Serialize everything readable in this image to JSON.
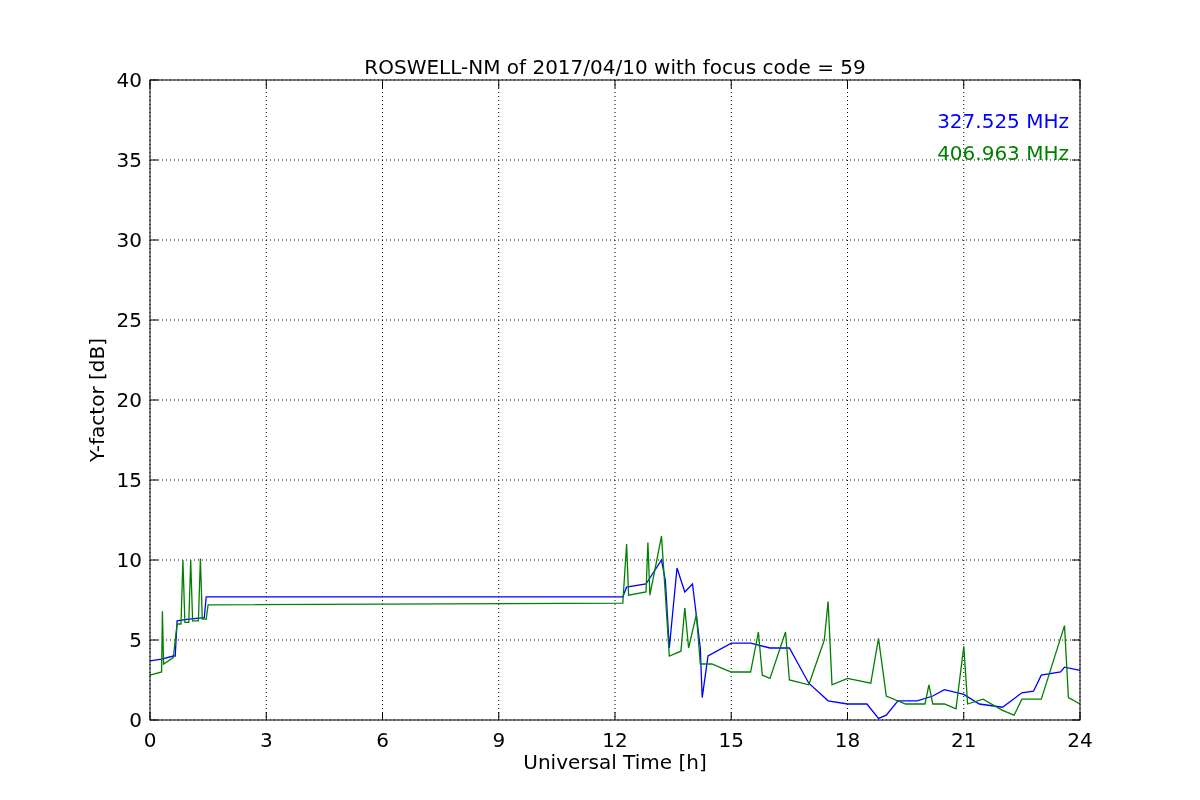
{
  "chart_data": {
    "type": "line",
    "title": "ROSWELL-NM of 2017/04/10 with focus code = 59",
    "xlabel": "Universal Time [h]",
    "ylabel": "Y-factor [dB]",
    "xlim": [
      0,
      24
    ],
    "ylim": [
      0,
      40
    ],
    "xticks": [
      0,
      3,
      6,
      9,
      12,
      15,
      18,
      21,
      24
    ],
    "yticks": [
      0,
      5,
      10,
      15,
      20,
      25,
      30,
      35,
      40
    ],
    "grid": true,
    "series": [
      {
        "name": "327.525 MHz",
        "color": "#0000ff",
        "x": [
          0,
          0.3,
          0.6,
          0.65,
          0.7,
          1.0,
          1.4,
          1.45,
          12.2,
          12.3,
          12.8,
          13.2,
          13.3,
          13.4,
          13.6,
          13.8,
          14.0,
          14.2,
          14.25,
          14.4,
          15,
          15.5,
          16,
          16.5,
          17,
          17.5,
          18,
          18.5,
          18.8,
          19.0,
          19.3,
          19.8,
          20.2,
          20.5,
          21,
          21.4,
          22,
          22.5,
          22.8,
          23,
          23.5,
          23.6,
          24
        ],
        "values": [
          3.7,
          3.8,
          4.0,
          4.0,
          6.2,
          6.3,
          6.4,
          7.7,
          7.7,
          8.3,
          8.5,
          10.0,
          8.7,
          4.5,
          9.5,
          8.0,
          8.5,
          4.5,
          1.4,
          4.0,
          4.8,
          4.8,
          4.5,
          4.5,
          2.3,
          1.2,
          1.0,
          1.0,
          0.1,
          0.3,
          1.2,
          1.2,
          1.5,
          1.9,
          1.6,
          1.0,
          0.8,
          1.7,
          1.8,
          2.8,
          3.0,
          3.3,
          3.1
        ]
      },
      {
        "name": "406.963 MHz",
        "color": "#008000",
        "x": [
          0,
          0.3,
          0.32,
          0.35,
          0.6,
          0.7,
          0.8,
          0.85,
          0.9,
          1.0,
          1.05,
          1.1,
          1.25,
          1.3,
          1.35,
          1.45,
          1.5,
          12.2,
          12.3,
          12.35,
          12.8,
          12.85,
          12.9,
          13.2,
          13.3,
          13.4,
          13.7,
          13.8,
          13.9,
          14.1,
          14.2,
          14.5,
          14.8,
          15,
          15.5,
          15.7,
          15.8,
          16,
          16.4,
          16.5,
          17,
          17.4,
          17.5,
          17.6,
          18,
          18.6,
          18.8,
          19,
          19.5,
          20,
          20.1,
          20.2,
          20.5,
          20.8,
          21.0,
          21.1,
          21.5,
          22,
          22.3,
          22.5,
          23,
          23.6,
          23.7,
          24
        ],
        "values": [
          2.8,
          3.0,
          6.8,
          3.5,
          3.9,
          6.0,
          6.0,
          10.0,
          6.1,
          6.1,
          10.0,
          6.2,
          6.2,
          10.1,
          6.3,
          6.3,
          7.2,
          7.3,
          11.0,
          7.8,
          8.0,
          11.1,
          7.8,
          11.5,
          7.8,
          4.0,
          4.3,
          7.0,
          4.5,
          6.6,
          3.5,
          3.5,
          3.2,
          3.0,
          3.0,
          5.5,
          2.8,
          2.6,
          5.5,
          2.5,
          2.2,
          5.0,
          7.4,
          2.2,
          2.6,
          2.3,
          5.1,
          1.5,
          1.0,
          1.0,
          2.2,
          1.0,
          1.0,
          0.7,
          4.6,
          1.0,
          1.3,
          0.6,
          0.3,
          1.3,
          1.3,
          5.9,
          1.4,
          1.0
        ]
      }
    ]
  }
}
